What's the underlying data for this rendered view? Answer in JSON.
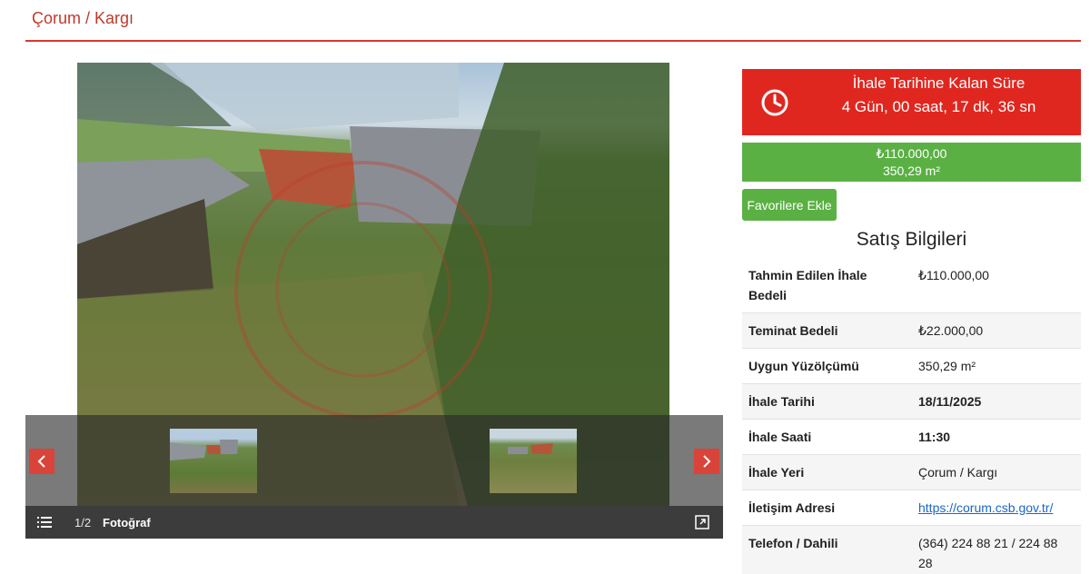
{
  "header": {
    "title": "Çorum / Kargı"
  },
  "gallery": {
    "counter": "1/2",
    "caption": "Fotoğraf",
    "prev_icon": "chevron-left-icon",
    "next_icon": "chevron-right-icon",
    "list_icon": "list-icon",
    "expand_icon": "expand-icon"
  },
  "countdown": {
    "title": "İhale Tarihine Kalan Süre",
    "value": "4 Gün, 00 saat, 17 dk, 36 sn",
    "icon": "clock-icon",
    "color": "#e0271f"
  },
  "price": {
    "amount": "₺110.000,00",
    "area": "350,29 m²",
    "color": "#5ab043"
  },
  "favorite_button": "Favorilere Ekle",
  "section_title": "Satış Bilgileri",
  "info": {
    "estimated_label": "Tahmin Edilen İhale Bedeli",
    "estimated_value": "₺110.000,00",
    "deposit_label": "Teminat Bedeli",
    "deposit_value": "₺22.000,00",
    "area_label": "Uygun Yüzölçümü",
    "area_value": "350,29 m²",
    "date_label": "İhale Tarihi",
    "date_value": "18/11/2025",
    "time_label": "İhale Saati",
    "time_value": "11:30",
    "place_label": "İhale Yeri",
    "place_value": "Çorum / Kargı",
    "contact_label": "İletişim Adresi",
    "contact_value": "https://corum.csb.gov.tr/",
    "phone_label": "Telefon / Dahili",
    "phone_value": "(364) 224 88 21 / 224 88 28"
  }
}
